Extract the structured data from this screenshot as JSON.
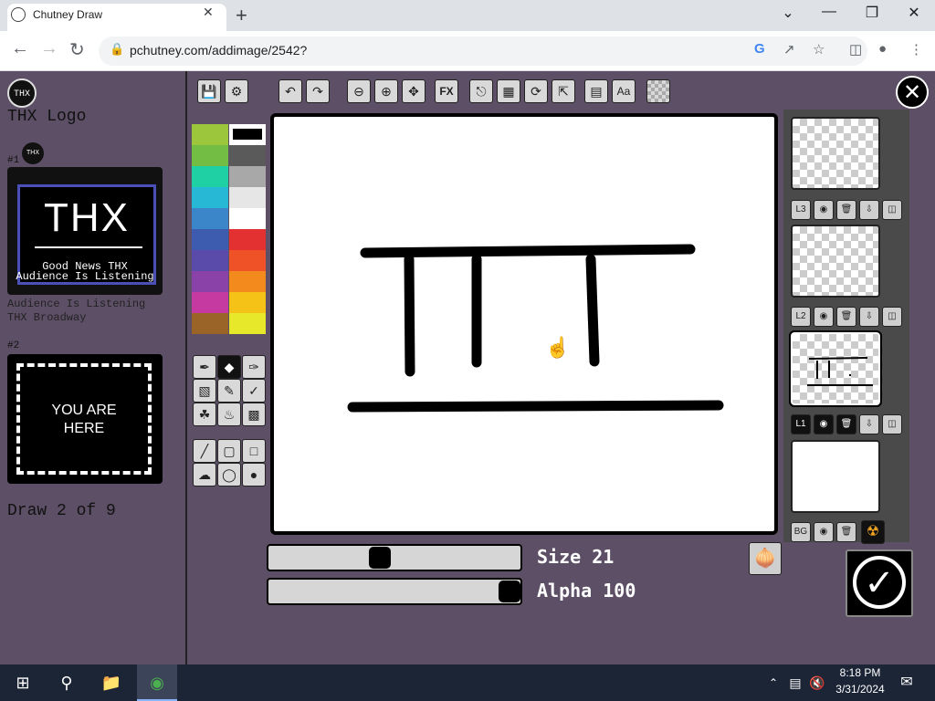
{
  "browser": {
    "tab_title": "Chutney Draw",
    "tab_close": "✕",
    "new_tab": "+",
    "url": "pchutney.com/addimage/2542?",
    "window_min": "—",
    "window_max": "❐",
    "window_close": "✕",
    "window_menu": "⌄"
  },
  "left": {
    "logo_text": "THX",
    "doc_title": "THX Logo",
    "entry1": {
      "num": "#1",
      "avatar_text": "THX",
      "big_text": "THX",
      "sub1": "Good News THX",
      "sub2": "Audience Is Listening",
      "cap1": "Audience Is Listening",
      "cap2": "THX Broadway"
    },
    "entry2": {
      "num": "#2",
      "line1": "YOU ARE",
      "line2": "HERE"
    },
    "progress": "Draw 2 of 9"
  },
  "toolbar": {
    "fx": "FX",
    "text_tool": "Aa"
  },
  "palette": {
    "colors": [
      "#9cc63c",
      "#ffffff",
      "#74bd44",
      "#5a5a5a",
      "#1fd0a4",
      "#a8a8a8",
      "#27b8d6",
      "#e6e6e6",
      "#3a86c8",
      "#ffffff",
      "#3d5cb0",
      "#e33030",
      "#5a4aaa",
      "#f05228",
      "#8a42a8",
      "#f28a1e",
      "#c43aa0",
      "#f5c318",
      "#9a6428",
      "#e8e82a"
    ],
    "selected": "#000000"
  },
  "sliders": {
    "size_label": "Size 21",
    "size_value": 21,
    "alpha_label": "Alpha 100",
    "alpha_value": 100
  },
  "layers": {
    "l3": "L3",
    "l2": "L2",
    "l1": "L1",
    "bg": "BG"
  },
  "taskbar": {
    "time": "8:18 PM",
    "date": "3/31/2024"
  }
}
